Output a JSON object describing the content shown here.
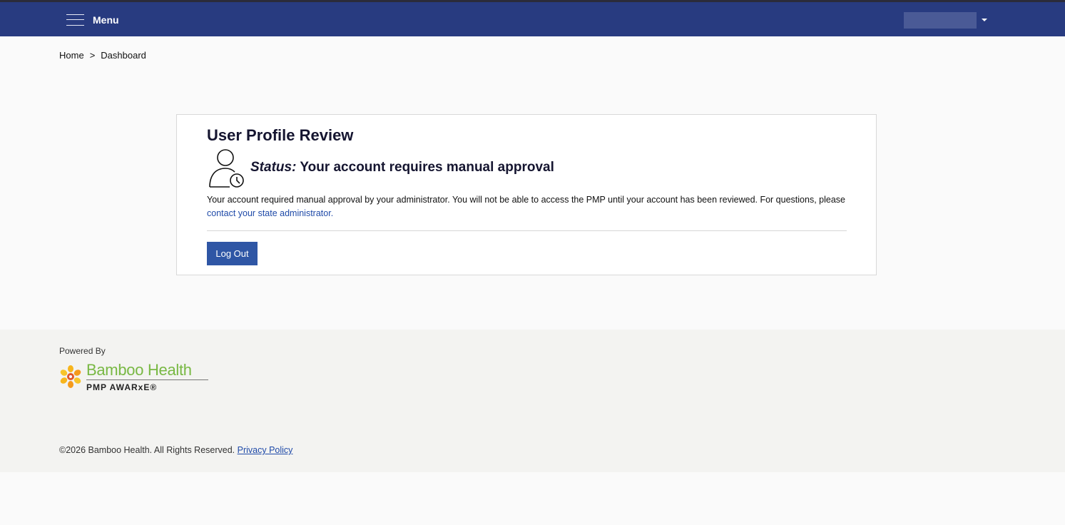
{
  "header": {
    "menu_label": "Menu",
    "user_dropdown_value": ""
  },
  "breadcrumb": {
    "home": "Home",
    "separator": ">",
    "current": "Dashboard"
  },
  "profile_review": {
    "title": "User Profile Review",
    "status_label": "Status:",
    "status_text": "Your account requires manual approval",
    "description": "Your account required manual approval by your administrator. You will not be able to access the PMP until your account has been reviewed. For questions, please ",
    "contact_link": "contact your state administrator.",
    "logout_button": "Log Out"
  },
  "footer": {
    "powered_by": "Powered By",
    "logo_name": "Bamboo Health",
    "logo_subtitle": "PMP AWARxE®",
    "copyright": "©2026 Bamboo Health. All Rights Reserved.",
    "privacy_link": "Privacy Policy"
  },
  "colors": {
    "navbar": "#283b80",
    "primary_button": "#2f56a5",
    "link": "#1f4aa8",
    "brand_green": "#78b843"
  }
}
